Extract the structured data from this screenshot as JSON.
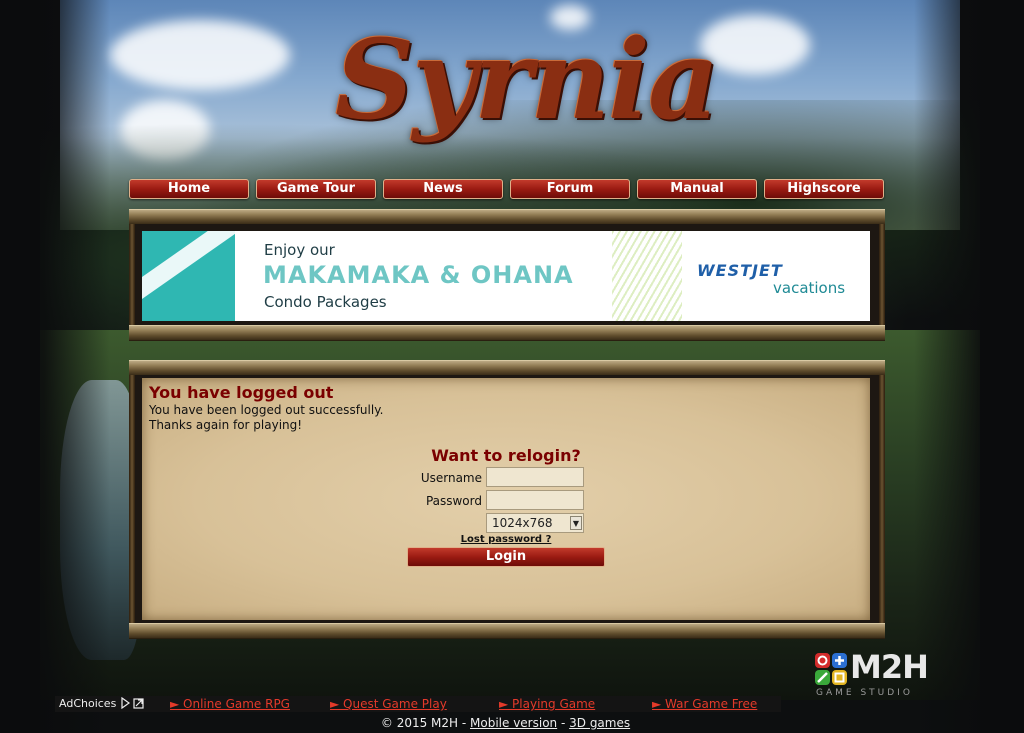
{
  "brand": {
    "logo_text": "Syrnia"
  },
  "nav": {
    "items": [
      {
        "label": "Home"
      },
      {
        "label": "Game Tour"
      },
      {
        "label": "News"
      },
      {
        "label": "Forum"
      },
      {
        "label": "Manual"
      },
      {
        "label": "Highscore"
      }
    ]
  },
  "ad_banner": {
    "line1": "Enjoy our",
    "line2": "MAKAMAKA & OHANA",
    "line3": "Condo Packages",
    "brand": "WESTJET",
    "brand_sub": "vacations"
  },
  "logout": {
    "title": "You have logged out",
    "message1": "You have been logged out successfully.",
    "message2": "Thanks again for playing!"
  },
  "relogin": {
    "title": "Want to relogin?",
    "username_label": "Username",
    "password_label": "Password",
    "username_value": "",
    "password_value": "",
    "resolution_selected": "1024x768",
    "lost_password_label": "Lost password ?",
    "login_label": "Login"
  },
  "studio": {
    "name": "M2H",
    "tagline": "GAME STUDIO"
  },
  "ad_links": {
    "adchoices": "AdChoices",
    "links": [
      "► Online Game RPG",
      "► Quest Game Play",
      "► Playing Game",
      "► War Game Free"
    ]
  },
  "footer": {
    "copyright": "© 2015 M2H - ",
    "mobile": "Mobile version",
    "sep": " - ",
    "games": "3D games"
  },
  "colors": {
    "accent_red": "#9b1b12",
    "heading_red": "#7a0000",
    "parchment": "#d8c198"
  }
}
